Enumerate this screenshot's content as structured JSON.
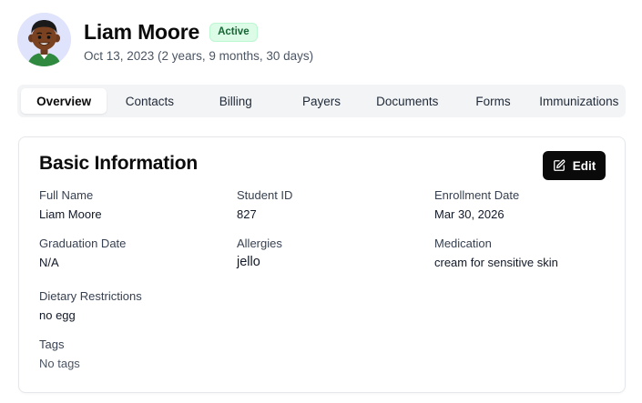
{
  "profile": {
    "name": "Liam Moore",
    "status": "Active",
    "date_line": "Oct 13, 2023 (2 years, 9 months, 30 days)"
  },
  "tabs": [
    {
      "label": "Overview",
      "active": true
    },
    {
      "label": "Contacts",
      "active": false
    },
    {
      "label": "Billing",
      "active": false
    },
    {
      "label": "Payers",
      "active": false
    },
    {
      "label": "Documents",
      "active": false
    },
    {
      "label": "Forms",
      "active": false
    },
    {
      "label": "Immunizations",
      "active": false
    }
  ],
  "card": {
    "title": "Basic Information",
    "edit_label": "Edit",
    "fields": {
      "full_name": {
        "label": "Full Name",
        "value": "Liam Moore"
      },
      "student_id": {
        "label": "Student ID",
        "value": "827"
      },
      "enrollment_date": {
        "label": "Enrollment Date",
        "value": "Mar 30, 2026"
      },
      "graduation_date": {
        "label": "Graduation Date",
        "value": "N/A"
      },
      "allergies": {
        "label": "Allergies",
        "value": "jello"
      },
      "medication": {
        "label": "Medication",
        "value": "cream for sensitive skin"
      },
      "dietary_restrictions": {
        "label": "Dietary Restrictions",
        "value": "no egg"
      },
      "tags": {
        "label": "Tags",
        "value": "No tags"
      }
    }
  },
  "colors": {
    "badge_bg": "#dcfce7",
    "badge_text": "#166534",
    "primary_button": "#0a0a0a",
    "avatar_bg": "#dfe3fb"
  },
  "icons": {
    "edit": "pencil-square-icon",
    "avatar": "avatar-cartoon-boy"
  }
}
